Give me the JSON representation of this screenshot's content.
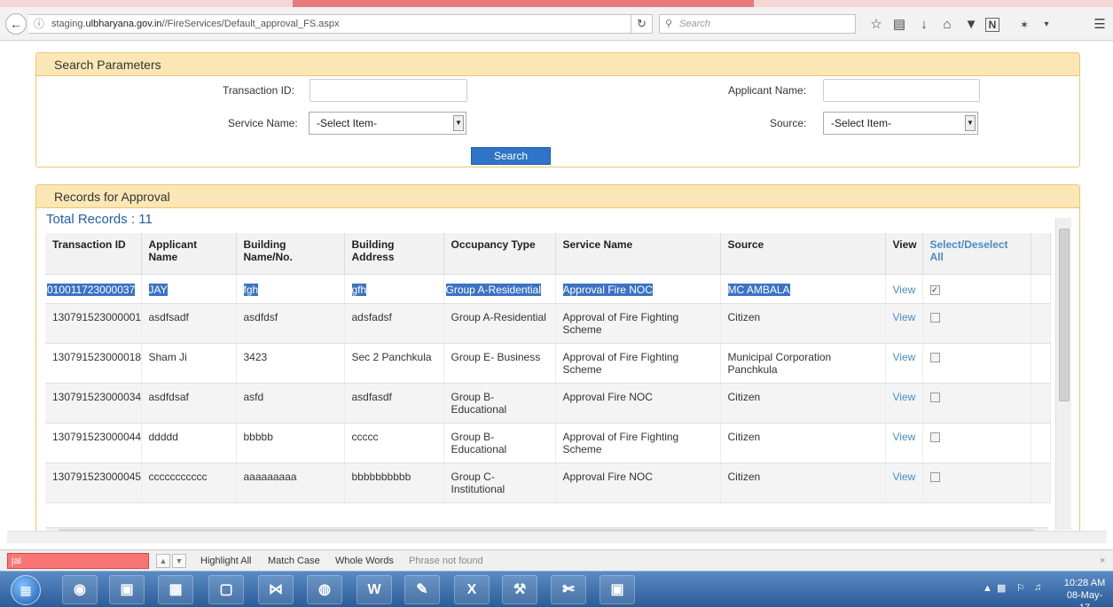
{
  "browser": {
    "url_prefix": "staging.",
    "url_host": "ulbharyana.gov.in",
    "url_path": "//FireServices/Default_approval_FS.aspx",
    "search_placeholder": "Search"
  },
  "search_panel": {
    "title": "Search Parameters",
    "transaction_id_label": "Transaction ID:",
    "transaction_id_value": "",
    "applicant_name_label": "Applicant Name:",
    "applicant_name_value": "",
    "service_name_label": "Service Name:",
    "service_name_selected": "-Select Item-",
    "source_label": "Source:",
    "source_selected": "-Select Item-",
    "search_button": "Search"
  },
  "records_panel": {
    "title": "Records for Approval",
    "total_records": "Total Records : 11",
    "columns": [
      "Transaction ID",
      "Applicant Name",
      "Building Name/No.",
      "Building Address",
      "Occupancy Type",
      "Service Name",
      "Source",
      "View",
      "Select/Deselect All"
    ],
    "rows": [
      {
        "transaction_id": "010011723000037",
        "applicant_name": "JAY",
        "building_name": "fgh",
        "building_address": "gfh",
        "occupancy_type": "Group A-Residential",
        "service_name": "Approval Fire NOC",
        "source": "MC AMBALA",
        "view": "View",
        "checked": true
      },
      {
        "transaction_id": "130791523000001",
        "applicant_name": "asdfsadf",
        "building_name": "asdfdsf",
        "building_address": "adsfadsf",
        "occupancy_type": "Group A-Residential",
        "service_name": "Approval of Fire Fighting Scheme",
        "source": "Citizen",
        "view": "View",
        "checked": false
      },
      {
        "transaction_id": "130791523000018",
        "applicant_name": "Sham Ji",
        "building_name": "3423",
        "building_address": "Sec 2 Panchkula",
        "occupancy_type": "Group E- Business",
        "service_name": "Approval of Fire Fighting Scheme",
        "source": "Municipal Corporation Panchkula",
        "view": "View",
        "checked": false
      },
      {
        "transaction_id": "130791523000034",
        "applicant_name": "asdfdsaf",
        "building_name": "asfd",
        "building_address": "asdfasdf",
        "occupancy_type": "Group B-Educational",
        "service_name": "Approval Fire NOC",
        "source": "Citizen",
        "view": "View",
        "checked": false
      },
      {
        "transaction_id": "130791523000044",
        "applicant_name": "ddddd",
        "building_name": "bbbbb",
        "building_address": "ccccc",
        "occupancy_type": "Group B-Educational",
        "service_name": "Approval of Fire Fighting Scheme",
        "source": "Citizen",
        "view": "View",
        "checked": false
      },
      {
        "transaction_id": "130791523000045",
        "applicant_name": "ccccccccccc",
        "building_name": "aaaaaaaaa",
        "building_address": "bbbbbbbbbb",
        "occupancy_type": "Group C-Institutional",
        "service_name": "Approval Fire NOC",
        "source": "Citizen",
        "view": "View",
        "checked": false
      }
    ]
  },
  "find_bar": {
    "query": "jai",
    "highlight_all": "Highlight All",
    "match_case": "Match Case",
    "whole_words": "Whole Words",
    "status": "Phrase not found"
  },
  "taskbar": {
    "time": "10:28 AM",
    "date": "08-May-17"
  },
  "colors": {
    "panel_header_bg": "#fbe7b5",
    "panel_border": "#f0c36d",
    "accent_blue": "#2f74c6",
    "link_blue": "#4a8ac7",
    "selection_blue": "#3b72c4",
    "find_not_found": "#f97575"
  },
  "icons": [
    "back-arrow-icon",
    "info-icon",
    "reload-icon",
    "search-icon",
    "star-icon",
    "reading-list-icon",
    "download-icon",
    "home-icon",
    "pocket-icon",
    "onenote-icon",
    "extension-icon",
    "menu-icon",
    "windows-start-icon",
    "firefox-icon",
    "file-icon",
    "paint-icon",
    "folder-icon",
    "visual-studio-icon",
    "chrome-icon",
    "word-icon",
    "ink-icon",
    "excel-icon",
    "tools-icon",
    "snipping-icon",
    "network-icon",
    "volume-icon"
  ]
}
